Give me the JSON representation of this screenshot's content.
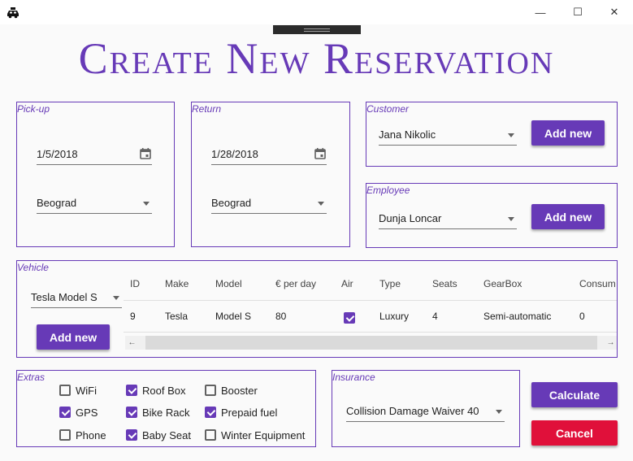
{
  "window": {
    "icon": "taxi-car-icon",
    "controls": {
      "minimize": "—",
      "maximize": "☐",
      "close": "✕"
    }
  },
  "title": "Create New Reservation",
  "pickup": {
    "label": "Pick-up",
    "date": "1/5/2018",
    "location": "Beograd"
  },
  "return": {
    "label": "Return",
    "date": "1/28/2018",
    "location": "Beograd"
  },
  "customer": {
    "label": "Customer",
    "selected": "Jana Nikolic",
    "add_label": "Add new"
  },
  "employee": {
    "label": "Employee",
    "selected": "Dunja Loncar",
    "add_label": "Add new"
  },
  "vehicle": {
    "label": "Vehicle",
    "selected": "Tesla Model S",
    "add_label": "Add new",
    "columns": [
      "ID",
      "Make",
      "Model",
      "€ per day",
      "Air",
      "Type",
      "Seats",
      "GearBox",
      "Consum"
    ],
    "rows": [
      {
        "id": "9",
        "make": "Tesla",
        "model": "Model S",
        "price": "80",
        "air": true,
        "type": "Luxury",
        "seats": "4",
        "gearbox": "Semi-automatic",
        "consumption": "0"
      }
    ],
    "scroll_left": "←",
    "scroll_right": "→"
  },
  "extras": {
    "label": "Extras",
    "items": [
      {
        "label": "WiFi",
        "checked": false
      },
      {
        "label": "GPS",
        "checked": true
      },
      {
        "label": "Phone",
        "checked": false
      },
      {
        "label": "Roof Box",
        "checked": true
      },
      {
        "label": "Bike Rack",
        "checked": true
      },
      {
        "label": "Baby Seat",
        "checked": true
      },
      {
        "label": "Booster",
        "checked": false
      },
      {
        "label": "Prepaid fuel",
        "checked": true
      },
      {
        "label": "Winter Equipment",
        "checked": false
      }
    ]
  },
  "insurance": {
    "label": "Insurance",
    "selected": "Collision Damage Waiver 40"
  },
  "actions": {
    "calculate": "Calculate",
    "cancel": "Cancel"
  },
  "colors": {
    "accent": "#673ab7",
    "danger": "#e0103a",
    "background": "#fafafa"
  }
}
